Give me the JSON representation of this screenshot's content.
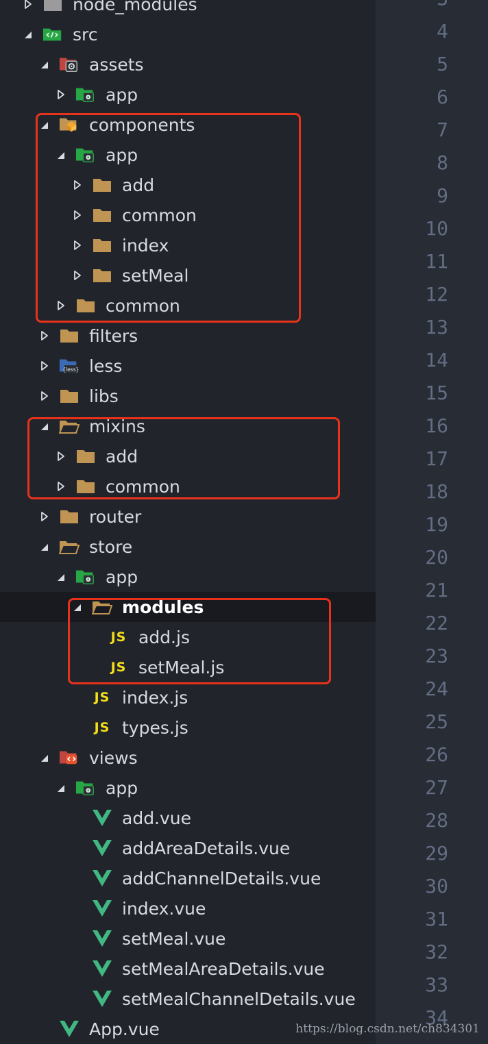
{
  "tree": {
    "items": [
      {
        "label": "node_modules",
        "depth": 1,
        "kind": "folder-special",
        "state": "collapsed",
        "clipped": true
      },
      {
        "label": "src",
        "depth": 1,
        "kind": "folder-src",
        "state": "expanded"
      },
      {
        "label": "assets",
        "depth": 2,
        "kind": "folder-assets",
        "state": "expanded"
      },
      {
        "label": "app",
        "depth": 3,
        "kind": "folder-app",
        "state": "collapsed"
      },
      {
        "label": "components",
        "depth": 2,
        "kind": "folder-components",
        "state": "expanded"
      },
      {
        "label": "app",
        "depth": 3,
        "kind": "folder-app",
        "state": "expanded"
      },
      {
        "label": "add",
        "depth": 4,
        "kind": "folder",
        "state": "collapsed"
      },
      {
        "label": "common",
        "depth": 4,
        "kind": "folder",
        "state": "collapsed"
      },
      {
        "label": "index",
        "depth": 4,
        "kind": "folder",
        "state": "collapsed"
      },
      {
        "label": "setMeal",
        "depth": 4,
        "kind": "folder",
        "state": "collapsed"
      },
      {
        "label": "common",
        "depth": 3,
        "kind": "folder",
        "state": "collapsed"
      },
      {
        "label": "filters",
        "depth": 2,
        "kind": "folder",
        "state": "collapsed"
      },
      {
        "label": "less",
        "depth": 2,
        "kind": "folder-less",
        "state": "collapsed"
      },
      {
        "label": "libs",
        "depth": 2,
        "kind": "folder",
        "state": "collapsed"
      },
      {
        "label": "mixins",
        "depth": 2,
        "kind": "folder-open",
        "state": "expanded"
      },
      {
        "label": "add",
        "depth": 3,
        "kind": "folder",
        "state": "collapsed"
      },
      {
        "label": "common",
        "depth": 3,
        "kind": "folder",
        "state": "collapsed"
      },
      {
        "label": "router",
        "depth": 2,
        "kind": "folder",
        "state": "collapsed"
      },
      {
        "label": "store",
        "depth": 2,
        "kind": "folder-open",
        "state": "expanded"
      },
      {
        "label": "app",
        "depth": 3,
        "kind": "folder-app",
        "state": "expanded"
      },
      {
        "label": "modules",
        "depth": 4,
        "kind": "folder-open",
        "state": "expanded",
        "selected": true
      },
      {
        "label": "add.js",
        "depth": 5,
        "kind": "js",
        "state": "none"
      },
      {
        "label": "setMeal.js",
        "depth": 5,
        "kind": "js",
        "state": "none"
      },
      {
        "label": "index.js",
        "depth": 4,
        "kind": "js",
        "state": "none"
      },
      {
        "label": "types.js",
        "depth": 4,
        "kind": "js",
        "state": "none"
      },
      {
        "label": "views",
        "depth": 2,
        "kind": "folder-views",
        "state": "expanded"
      },
      {
        "label": "app",
        "depth": 3,
        "kind": "folder-app",
        "state": "expanded"
      },
      {
        "label": "add.vue",
        "depth": 4,
        "kind": "vue",
        "state": "none"
      },
      {
        "label": "addAreaDetails.vue",
        "depth": 4,
        "kind": "vue",
        "state": "none"
      },
      {
        "label": "addChannelDetails.vue",
        "depth": 4,
        "kind": "vue",
        "state": "none"
      },
      {
        "label": "index.vue",
        "depth": 4,
        "kind": "vue",
        "state": "none"
      },
      {
        "label": "setMeal.vue",
        "depth": 4,
        "kind": "vue",
        "state": "none"
      },
      {
        "label": "setMealAreaDetails.vue",
        "depth": 4,
        "kind": "vue",
        "state": "none"
      },
      {
        "label": "setMealChannelDetails.vue",
        "depth": 4,
        "kind": "vue",
        "state": "none"
      },
      {
        "label": "App.vue",
        "depth": 2,
        "kind": "vue",
        "state": "none"
      }
    ]
  },
  "gutter": {
    "line_numbers": [
      "3",
      "4",
      "5",
      "6",
      "7",
      "8",
      "9",
      "10",
      "11",
      "12",
      "13",
      "14",
      "15",
      "16",
      "17",
      "18",
      "19",
      "20",
      "21",
      "22",
      "23",
      "24",
      "25",
      "26",
      "27",
      "28",
      "29",
      "30",
      "31",
      "32",
      "33",
      "34"
    ]
  },
  "highlights": [
    {
      "name": "highlight-components"
    },
    {
      "name": "highlight-mixins"
    },
    {
      "name": "highlight-modules"
    }
  ],
  "icon_text": {
    "js": "JS",
    "less": "{less}"
  },
  "colors": {
    "sidebar_bg": "#21252b",
    "gutter_bg": "#282c34",
    "text": "#d7dae0",
    "line_number": "#636d83",
    "folder": "#c09553",
    "folder_app": "#27a645",
    "js": "#f5de19",
    "vue": "#41b883",
    "highlight": "#e8321b"
  },
  "watermark": "https://blog.csdn.net/ch834301"
}
